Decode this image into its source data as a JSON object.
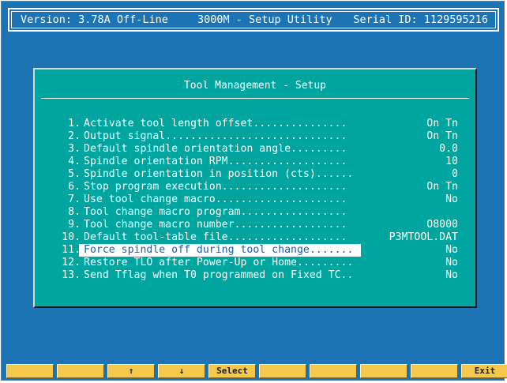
{
  "header": {
    "version": "Version: 3.78A Off-Line",
    "app_title": "3000M - Setup Utility",
    "serial": "Serial ID: 1129595216"
  },
  "dialog": {
    "title": "Tool Management - Setup",
    "rows": [
      {
        "num": "1.",
        "label": "Activate tool length offset...............",
        "value": "On Tn"
      },
      {
        "num": "2.",
        "label": "Output signal.............................",
        "value": "On Tn"
      },
      {
        "num": "3.",
        "label": "Default spindle orientation angle.........",
        "value": "0.0"
      },
      {
        "num": "4.",
        "label": "Spindle orientation RPM...................",
        "value": "10"
      },
      {
        "num": "5.",
        "label": "Spindle orientation in position (cts)......",
        "value": "0"
      },
      {
        "num": "6.",
        "label": "Stop program execution....................",
        "value": "On Tn"
      },
      {
        "num": "7.",
        "label": "Use tool change macro.....................",
        "value": "No"
      },
      {
        "num": "8.",
        "label": "Tool change macro program.................",
        "value": ""
      },
      {
        "num": "9.",
        "label": "Tool change macro number..................",
        "value": "O8000"
      },
      {
        "num": "10.",
        "label": "Default tool-table file...................",
        "value": "P3MTOOL.DAT"
      },
      {
        "num": "11.",
        "label": "Force spindle off during tool change.......",
        "value": "No",
        "selected": true
      },
      {
        "num": "12.",
        "label": "Restore TLO after Power-Up or Home.........",
        "value": "No"
      },
      {
        "num": "13.",
        "label": "Send Tflag when T0 programmed on Fixed TC..",
        "value": "No"
      }
    ]
  },
  "fkeys": [
    "",
    "",
    "↑",
    "↓",
    "Select",
    "",
    "",
    "",
    "",
    "Exit"
  ],
  "colors": {
    "screen_bg": "#1c74b4",
    "dialog_bg": "#00a5a0",
    "fkey_bg": "#f4c84a",
    "highlight_bg": "#ffffff",
    "highlight_text": "#1c5fae"
  }
}
